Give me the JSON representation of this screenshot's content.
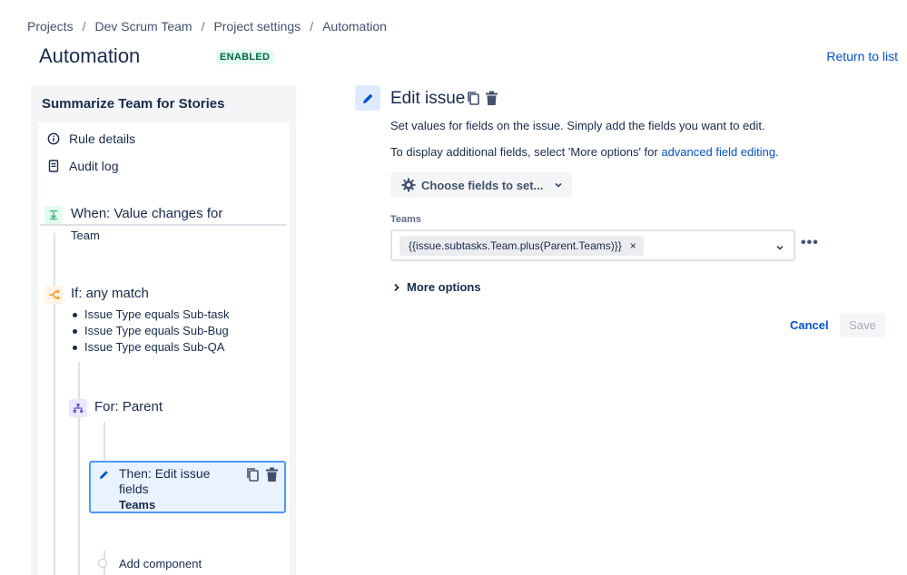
{
  "breadcrumb": {
    "items": [
      "Projects",
      "Dev Scrum Team",
      "Project settings",
      "Automation"
    ],
    "separator": "/"
  },
  "header": {
    "title": "Automation",
    "status": "ENABLED",
    "return_link": "Return to list"
  },
  "rule": {
    "name": "Summarize Team for Stories",
    "links": [
      {
        "label": "Rule details",
        "icon": "info-icon"
      },
      {
        "label": "Audit log",
        "icon": "document-icon"
      }
    ],
    "trigger": {
      "title": "When: Value changes for",
      "detail": "Team",
      "icon": "trigger-icon"
    },
    "condition": {
      "title": "If: any match",
      "icon": "branch-condition-icon",
      "items": [
        "Issue Type equals Sub-task",
        "Issue Type equals Sub-Bug",
        "Issue Type equals Sub-QA"
      ]
    },
    "branch": {
      "title": "For: Parent",
      "icon": "hierarchy-icon"
    },
    "action": {
      "title": "Then: Edit issue fields",
      "detail": "Teams",
      "icon": "pencil-icon"
    },
    "add_component": "Add component"
  },
  "editor": {
    "title": "Edit issue",
    "description": "Set values for fields on the issue. Simply add the fields you want to edit.",
    "advanced_prefix": "To display additional fields, select 'More options' for ",
    "advanced_link": "advanced field editing",
    "advanced_suffix": ".",
    "choose_fields": "Choose fields to set...",
    "field_label": "Teams",
    "field_value": "{{issue.subtasks.Team.plus(Parent.Teams)}}",
    "tag_remove": "×",
    "more_dots": "•••",
    "more_options": "More options",
    "cancel": "Cancel",
    "save": "Save"
  },
  "colors": {
    "accent": "#0052cc",
    "selected_bg": "#e9f2ff",
    "selected_border": "#4c9aff",
    "enabled_bg": "#e3fcef",
    "enabled_text": "#006644",
    "trigger": "#36b37e",
    "condition": "#ff991f",
    "branch": "#6554c0"
  }
}
